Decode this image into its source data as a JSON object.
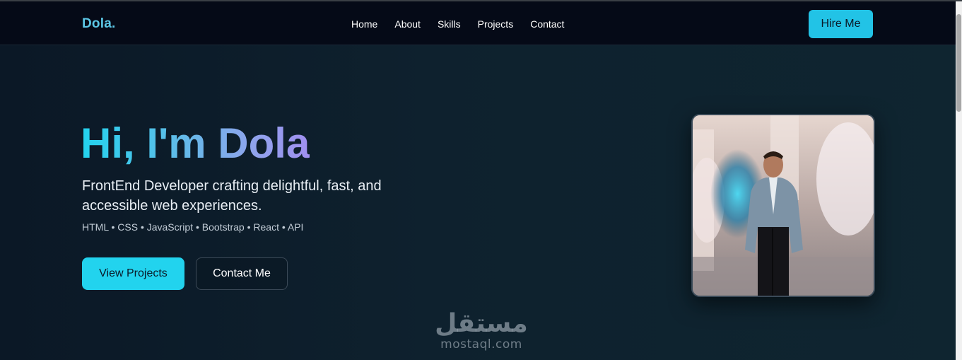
{
  "navbar": {
    "logo": "Dola.",
    "links": [
      "Home",
      "About",
      "Skills",
      "Projects",
      "Contact"
    ],
    "hire_label": "Hire Me"
  },
  "hero": {
    "title": "Hi, I'm Dola",
    "subtitle": "FrontEnd Developer crafting delightful, fast, and accessible web experiences.",
    "tags": "HTML • CSS • JavaScript • Bootstrap • React • API",
    "primary_button": "View Projects",
    "secondary_button": "Contact Me"
  },
  "watermark": {
    "arabic": "مستقل",
    "latin": "mostaql.com"
  },
  "colors": {
    "accent": "#22d3ee",
    "nav_bg": "#050a17",
    "page_bg": "#0e212e",
    "title_gradient_end": "#a08ff0"
  }
}
